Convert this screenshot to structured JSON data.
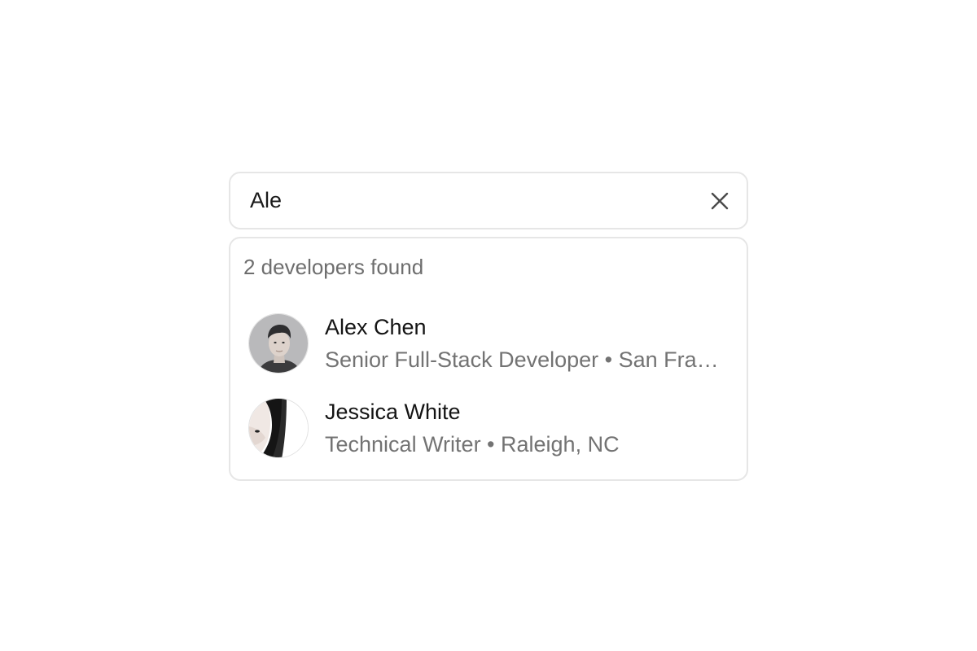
{
  "search": {
    "value": "Ale",
    "clear_icon": "close-icon"
  },
  "results": {
    "count_text": "2 developers found",
    "items": [
      {
        "name": "Alex Chen",
        "subtitle": "Senior Full-Stack Developer • San Francisco, CA",
        "avatar_icon": "avatar-photo"
      },
      {
        "name": "Jessica White",
        "subtitle": "Technical Writer • Raleigh, NC",
        "avatar_icon": "avatar-photo"
      }
    ]
  },
  "colors": {
    "border": "#e6e6e6",
    "primary_text": "#141414",
    "secondary_text": "#737373",
    "background": "#ffffff"
  }
}
